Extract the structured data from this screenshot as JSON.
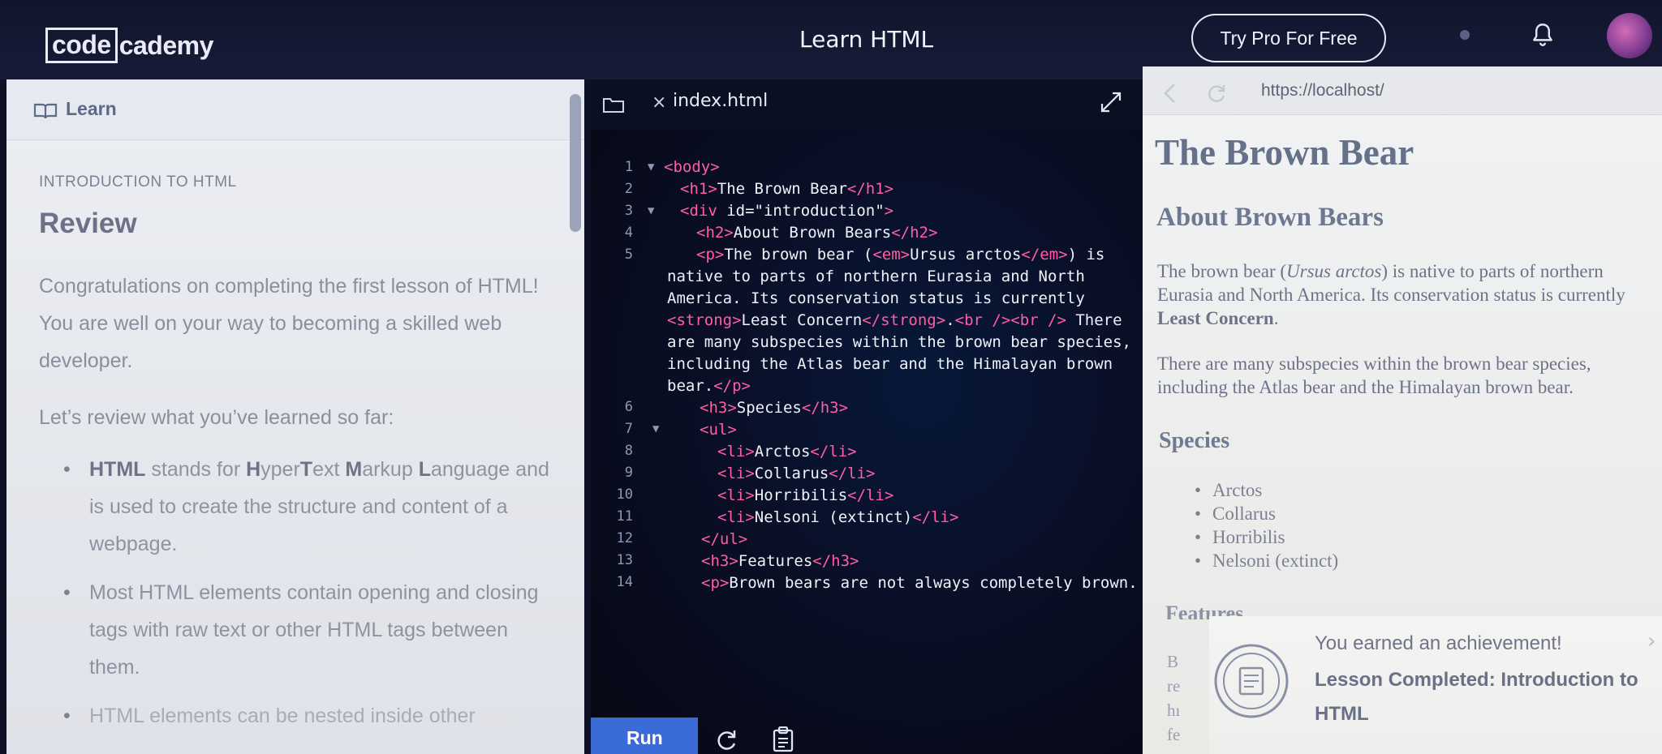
{
  "header": {
    "logo_left": "code",
    "logo_right": "cademy",
    "title": "Learn HTML",
    "pro_button": "Try Pro For Free"
  },
  "learn_panel": {
    "tab_label": "Learn",
    "breadcrumb": "INTRODUCTION TO HTML",
    "title": "Review",
    "intro": "Congratulations on completing the first lesson of HTML! You are well on your way to becoming a skilled web developer.",
    "lead": "Let’s review what you’ve learned so far:",
    "bullets": [
      {
        "strong": "HTML",
        "prefix": " stands for ",
        "h": "H",
        "rest1": "yper",
        "t": "T",
        "rest2": "ext ",
        "m": "M",
        "rest3": "arkup ",
        "l": "L",
        "rest4": "anguage and is used to create the structure and content of a webpage."
      },
      {
        "text": "Most HTML elements contain opening and closing tags with raw text or other HTML tags between them."
      },
      {
        "text": "HTML elements can be nested inside other"
      }
    ]
  },
  "editor": {
    "file_tab": "index.html",
    "run_label": "Run",
    "line_numbers": [
      "1",
      "2",
      "3",
      "4",
      "5",
      "6",
      "7",
      "8",
      "9",
      "10",
      "11",
      "12",
      "13",
      "14"
    ]
  },
  "preview": {
    "url": "https://localhost/",
    "h1": "The Brown Bear",
    "h2": "About Brown Bears",
    "p1_a": "The brown bear (",
    "p1_em": "Ursus arctos",
    "p1_b": ") is native to parts of northern Eurasia and North America. Its conservation status is currently ",
    "p1_strong": "Least Concern",
    "p1_c": ".",
    "p2": "There are many subspecies within the brown bear species, including the Atlas bear and the Himalayan brown bear.",
    "h3": "Species",
    "species": [
      "Arctos",
      "Collarus",
      "Horribilis",
      "Nelsoni (extinct)"
    ],
    "h3b": "Features",
    "fragments": [
      "B",
      "re",
      "hı",
      "fe"
    ]
  },
  "toast": {
    "small": "You earned an achievement!",
    "title": "Lesson Completed: Introduction to HTML"
  }
}
